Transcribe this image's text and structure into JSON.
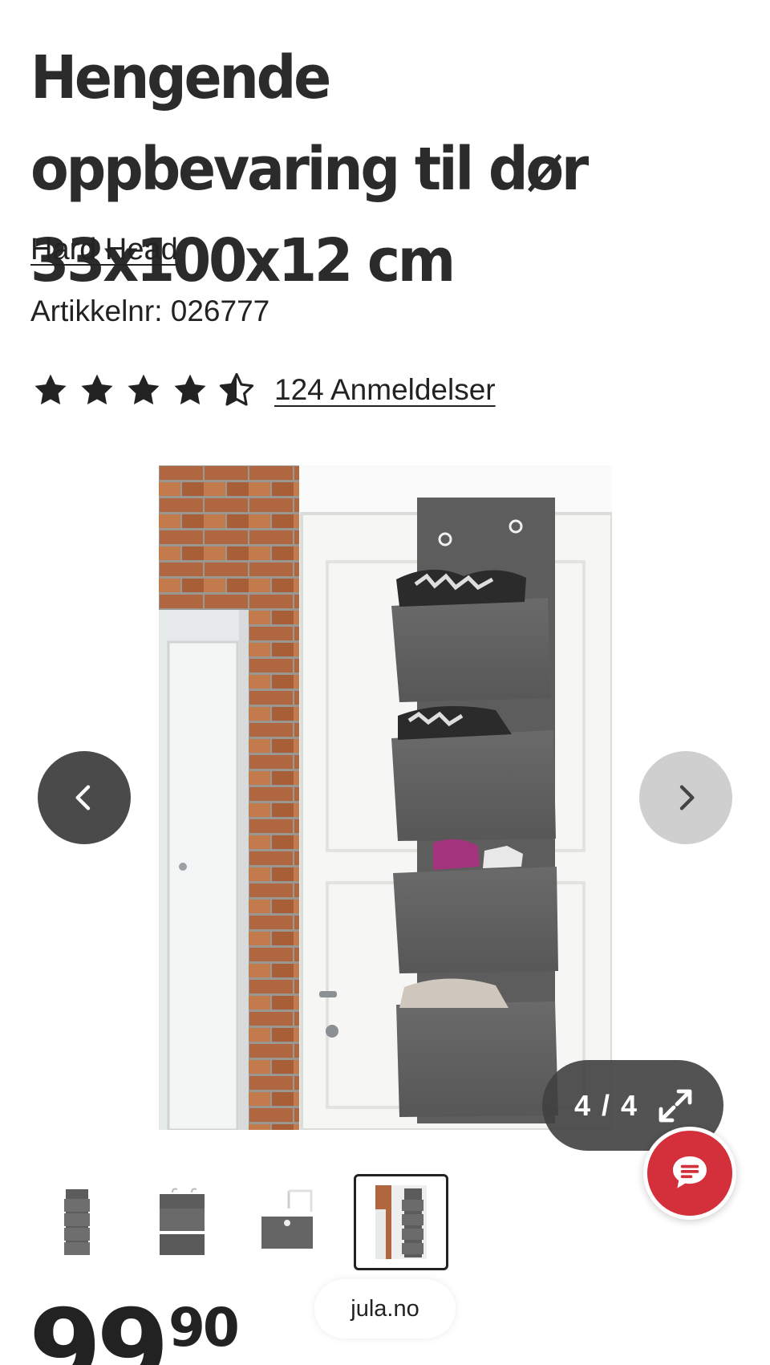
{
  "product": {
    "title": "Hengende oppbevaring til dør 33x100x12 cm",
    "brand": "Hard Head",
    "sku_label": "Artikkelnr:",
    "sku_value": "026777",
    "rating": {
      "value": 4.5,
      "max": 5,
      "reviews_label": "124 Anmeldelser"
    },
    "price": {
      "whole": "99",
      "decimals": "90"
    }
  },
  "gallery": {
    "counter": "4 / 4",
    "current": 4,
    "total": 4
  },
  "footer": {
    "site_label": "jula.no"
  },
  "colors": {
    "text": "#222222",
    "chat_button": "#d3303c",
    "nav_prev_bg": "#4a4a4a",
    "nav_next_bg": "#cfcfcf",
    "counter_bg": "#404040"
  },
  "icons": {
    "prev": "chevron-left-icon",
    "next": "chevron-right-icon",
    "expand": "expand-icon",
    "chat": "chat-icon",
    "star": "star-icon"
  }
}
